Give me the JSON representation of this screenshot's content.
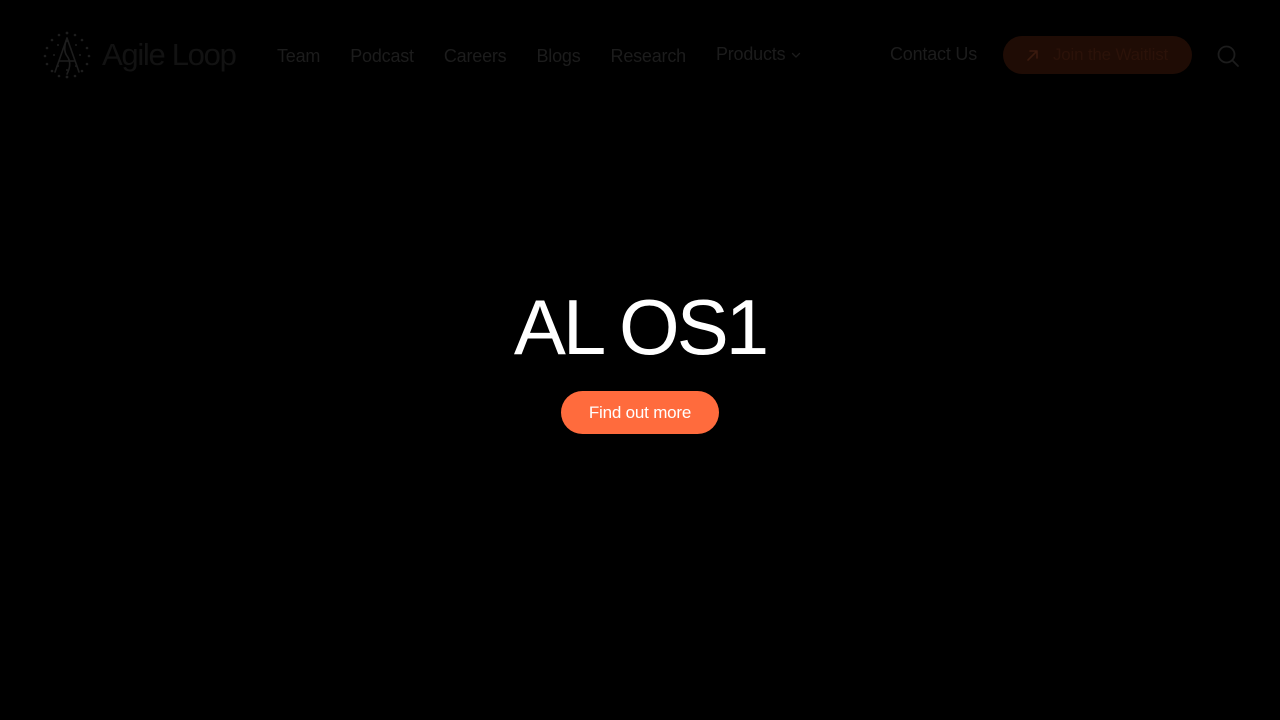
{
  "brand": {
    "name": "Agile Loop",
    "logo_icon": "agile-loop-mark-icon"
  },
  "nav": {
    "items": [
      {
        "label": "Team"
      },
      {
        "label": "Podcast"
      },
      {
        "label": "Careers"
      },
      {
        "label": "Blogs"
      },
      {
        "label": "Research"
      }
    ],
    "products": {
      "label": "Products",
      "icon": "chevron-down-icon"
    }
  },
  "actions": {
    "contact_label": "Contact Us",
    "waitlist": {
      "label": "Join the Waitlist",
      "icon": "arrow-up-right-icon"
    },
    "search": {
      "icon": "search-icon"
    }
  },
  "hero": {
    "title": "AL OS1",
    "cta_label": "Find out more"
  },
  "colors": {
    "background": "#000000",
    "accent": "#ff6b3d",
    "header_text": "#1c1c1c",
    "waitlist_bg": "#1f0c05",
    "hero_text": "#ffffff"
  }
}
